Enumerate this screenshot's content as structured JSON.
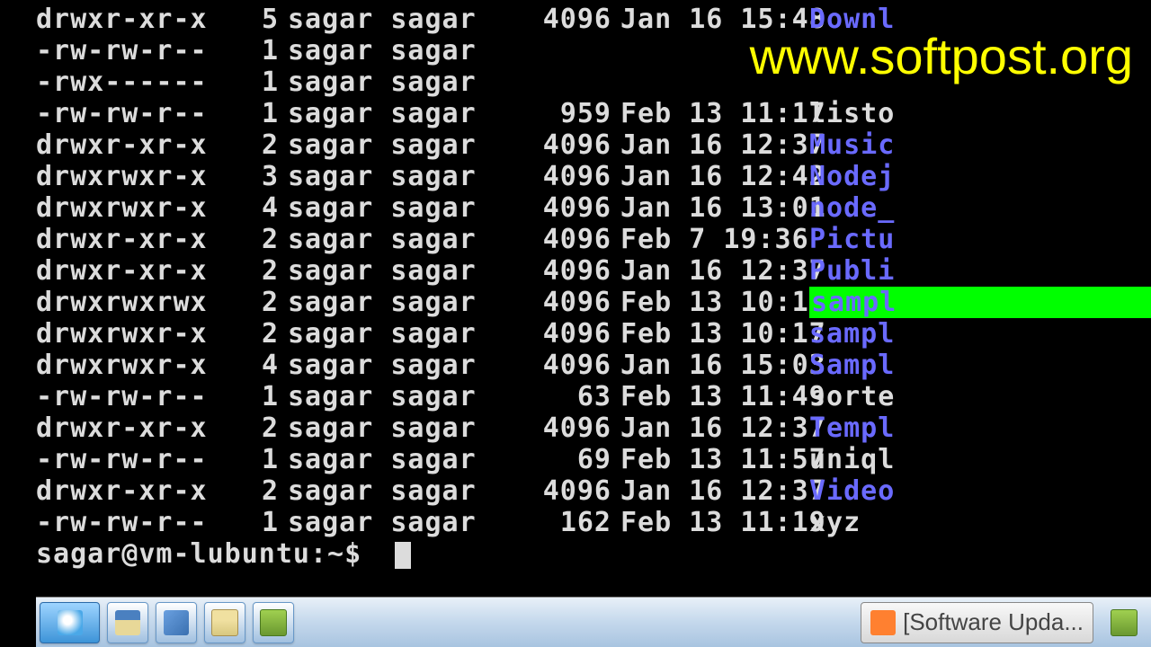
{
  "watermark": "www.softpost.org",
  "listing": [
    {
      "perm": "drwxr-xr-x",
      "links": "5",
      "owner": "sagar sagar",
      "size": "4096",
      "date": "Jan 16 15:48",
      "name": "Downl",
      "cls": "c-dir"
    },
    {
      "perm": "-rw-rw-r--",
      "links": "1",
      "owner": "sagar sagar",
      "size": "",
      "date": "",
      "name": "",
      "cls": "c-file"
    },
    {
      "perm": "-rwx------",
      "links": "1",
      "owner": "sagar sagar",
      "size": "",
      "date": "",
      "name": "",
      "cls": "c-exec"
    },
    {
      "perm": "-rw-rw-r--",
      "links": "1",
      "owner": "sagar sagar",
      "size": "959",
      "date": "Feb 13 11:17",
      "name": "listo",
      "cls": "c-file"
    },
    {
      "perm": "drwxr-xr-x",
      "links": "2",
      "owner": "sagar sagar",
      "size": "4096",
      "date": "Jan 16 12:37",
      "name": "Music",
      "cls": "c-dir"
    },
    {
      "perm": "drwxrwxr-x",
      "links": "3",
      "owner": "sagar sagar",
      "size": "4096",
      "date": "Jan 16 12:42",
      "name": "Nodej",
      "cls": "c-dir"
    },
    {
      "perm": "drwxrwxr-x",
      "links": "4",
      "owner": "sagar sagar",
      "size": "4096",
      "date": "Jan 16 13:01",
      "name": "node_",
      "cls": "c-dir"
    },
    {
      "perm": "drwxr-xr-x",
      "links": "2",
      "owner": "sagar sagar",
      "size": "4096",
      "date": "Feb  7 19:36",
      "name": "Pictu",
      "cls": "c-dir"
    },
    {
      "perm": "drwxr-xr-x",
      "links": "2",
      "owner": "sagar sagar",
      "size": "4096",
      "date": "Jan 16 12:37",
      "name": "Publi",
      "cls": "c-dir"
    },
    {
      "perm": "drwxrwxrwx",
      "links": "2",
      "owner": "sagar sagar",
      "size": "4096",
      "date": "Feb 13 10:13",
      "name": "sampl",
      "cls": "c-other"
    },
    {
      "perm": "drwxrwxr-x",
      "links": "2",
      "owner": "sagar sagar",
      "size": "4096",
      "date": "Feb 13 10:17",
      "name": "sampl",
      "cls": "c-dir"
    },
    {
      "perm": "drwxrwxr-x",
      "links": "4",
      "owner": "sagar sagar",
      "size": "4096",
      "date": "Jan 16 15:03",
      "name": "Sampl",
      "cls": "c-dir"
    },
    {
      "perm": "-rw-rw-r--",
      "links": "1",
      "owner": "sagar sagar",
      "size": "63",
      "date": "Feb 13 11:49",
      "name": "sorte",
      "cls": "c-file"
    },
    {
      "perm": "drwxr-xr-x",
      "links": "2",
      "owner": "sagar sagar",
      "size": "4096",
      "date": "Jan 16 12:37",
      "name": "Templ",
      "cls": "c-dir"
    },
    {
      "perm": "-rw-rw-r--",
      "links": "1",
      "owner": "sagar sagar",
      "size": "69",
      "date": "Feb 13 11:57",
      "name": "uniql",
      "cls": "c-file"
    },
    {
      "perm": "drwxr-xr-x",
      "links": "2",
      "owner": "sagar sagar",
      "size": "4096",
      "date": "Jan 16 12:37",
      "name": "Video",
      "cls": "c-dir"
    },
    {
      "perm": "-rw-rw-r--",
      "links": "1",
      "owner": "sagar sagar",
      "size": "162",
      "date": "Feb 13 11:19",
      "name": "xyz",
      "cls": "c-file"
    }
  ],
  "prompt": "sagar@vm-lubuntu:~$",
  "taskbar": {
    "software_updater": "[Software Upda..."
  }
}
